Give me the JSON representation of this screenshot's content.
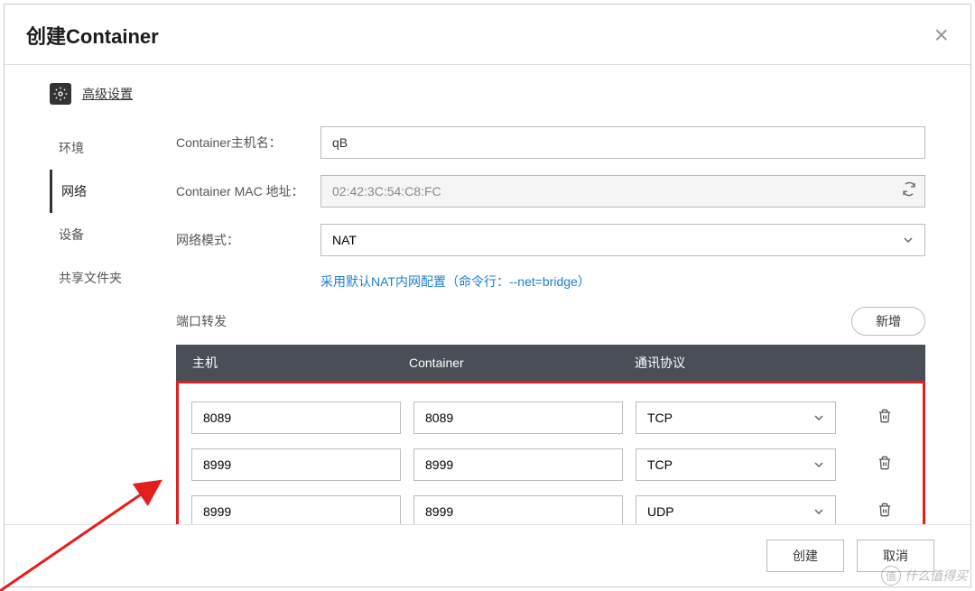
{
  "header": {
    "title": "创建Container"
  },
  "adv_settings": {
    "label": "高级设置"
  },
  "nav": {
    "items": [
      {
        "label": "环境",
        "active": false
      },
      {
        "label": "网络",
        "active": true
      },
      {
        "label": "设备",
        "active": false
      },
      {
        "label": "共享文件夹",
        "active": false
      }
    ]
  },
  "form": {
    "hostname_label": "Container主机名：",
    "hostname_value": "qB",
    "mac_label": "Container MAC 地址：",
    "mac_value": "02:42:3C:54:C8:FC",
    "netmode_label": "网络模式：",
    "netmode_value": "NAT",
    "hint": "采用默认NAT内网配置（命令行：--net=bridge）",
    "pf_label": "端口转发",
    "add_label": "新增"
  },
  "pf_table": {
    "headers": {
      "host": "主机",
      "container": "Container",
      "protocol": "通讯协议"
    },
    "rows": [
      {
        "host": "8089",
        "container": "8089",
        "protocol": "TCP"
      },
      {
        "host": "8999",
        "container": "8999",
        "protocol": "TCP"
      },
      {
        "host": "8999",
        "container": "8999",
        "protocol": "UDP"
      }
    ]
  },
  "footer": {
    "create": "创建",
    "cancel": "取消"
  },
  "watermark": "什么值得买"
}
